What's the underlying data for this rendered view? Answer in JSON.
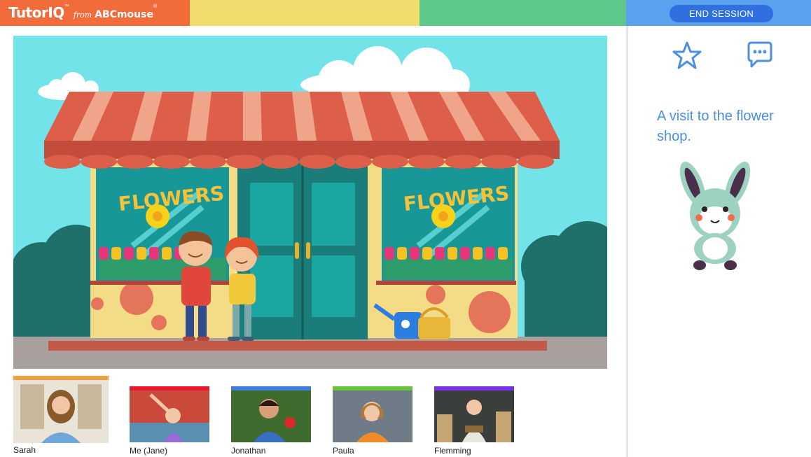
{
  "brand": {
    "name": "TutorIQ",
    "tm": "™",
    "from": "from",
    "partner": "ABCmouse",
    "partner_mark": "®"
  },
  "header": {
    "end_session_label": "END SESSION"
  },
  "lesson": {
    "description": "A visit to the flower shop.",
    "scene": {
      "sign_left": "FLOWERS",
      "sign_right": "FLOWERS"
    }
  },
  "toolbar": {
    "star_icon": "star-icon",
    "chat_icon": "chat-bubble-icon"
  },
  "participants": [
    {
      "name": "Sarah",
      "color": "#f2a23c"
    },
    {
      "name": "Me (Jane)",
      "color": "#e8192c"
    },
    {
      "name": "Jonathan",
      "color": "#3b7fd9"
    },
    {
      "name": "Paula",
      "color": "#64c43a"
    },
    {
      "name": "Flemming",
      "color": "#7a2ee8"
    }
  ],
  "colors": {
    "orange": "#f26b3a",
    "yellow": "#f2dc6b",
    "green": "#5cc98a",
    "blue": "#5aa2ee",
    "accent": "#2f6fe0"
  }
}
